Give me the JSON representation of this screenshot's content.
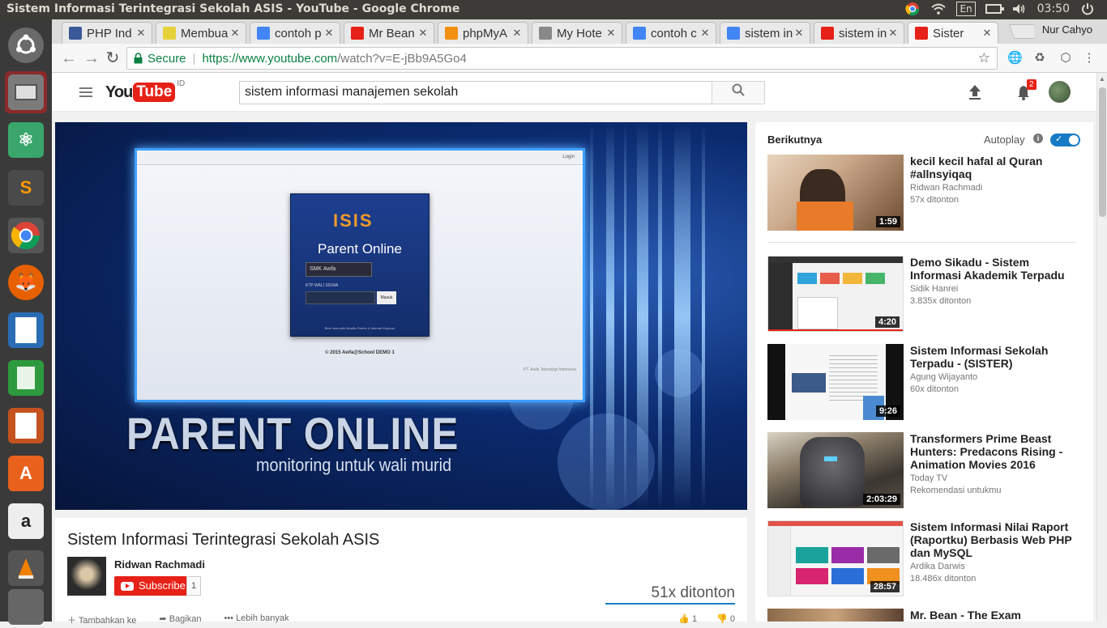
{
  "system": {
    "window_title": "Sistem Informasi Terintegrasi Sekolah ASIS - YouTube - Google Chrome",
    "lang": "En",
    "time": "03:50"
  },
  "tabs": [
    {
      "label": "PHP Ind",
      "icon": "facebook-icon",
      "color": "#3b5998"
    },
    {
      "label": "Membua",
      "icon": "chat-icon",
      "color": "#e6d13a"
    },
    {
      "label": "contoh p",
      "icon": "google-icon",
      "color": "#4285f4"
    },
    {
      "label": "Mr Bean",
      "icon": "youtube-icon",
      "color": "#e62117"
    },
    {
      "label": "phpMyA",
      "icon": "phpmyadmin-icon",
      "color": "#f29111"
    },
    {
      "label": "My Hote",
      "icon": "page-icon",
      "color": "#888888"
    },
    {
      "label": "contoh c",
      "icon": "google-icon",
      "color": "#4285f4"
    },
    {
      "label": "sistem in",
      "icon": "google-icon",
      "color": "#4285f4"
    },
    {
      "label": "sistem in",
      "icon": "youtube-icon",
      "color": "#e62117"
    },
    {
      "label": "Sister",
      "icon": "youtube-icon",
      "color": "#e62117"
    }
  ],
  "profile_name": "Nur Cahyo",
  "omnibox": {
    "secure_label": "Secure",
    "url_host": "https://www.youtube.com",
    "url_path": "/watch?v=E-jBb9A5Go4"
  },
  "youtube": {
    "logo_you": "You",
    "logo_tube": "Tube",
    "country": "ID",
    "search_value": "sistem informasi manajemen sekolah",
    "notifications": "2"
  },
  "player": {
    "screen_login": "Login",
    "isis_logo": "ISIS",
    "parent_online": "Parent Online",
    "school_select": "SMK Awfa",
    "ktp_label": "KTP WALI SISWA",
    "masuk": "Masuk",
    "best_view": "Best view with Mozilla Firefox & Internet Explorer",
    "copyright": "© 2015 Awfa@School DEMO 1",
    "company": "PT. Awfa Teknologi Indonesia",
    "headline": "PARENT ONLINE",
    "subheadline": "monitoring untuk wali murid"
  },
  "video": {
    "title": "Sistem Informasi Terintegrasi Sekolah ASIS",
    "channel": "Ridwan Rachmadi",
    "subscribe": "Subscribe",
    "subscriber_count": "1",
    "views": "51x ditonton",
    "actions": [
      "Tambahkan ke",
      "Bagikan",
      "Lebih banyak"
    ],
    "likes": "1",
    "dislikes": "0"
  },
  "sidebar": {
    "up_next": "Berikutnya",
    "autoplay": "Autoplay",
    "autoplay_on": true,
    "videos": [
      {
        "title": "kecil kecil hafal al Quran #allnsyiqaq",
        "channel": "Ridwan Rachmadi",
        "views": "57x ditonton",
        "duration": "1:59"
      },
      {
        "title": "Demo Sikadu - Sistem Informasi Akademik Terpadu",
        "channel": "Sidik Hanrei",
        "views": "3.835x ditonton",
        "duration": "4:20"
      },
      {
        "title": "Sistem Informasi Sekolah Terpadu - (SISTER)",
        "channel": "Agung Wijayanto",
        "views": "60x ditonton",
        "duration": "9:26"
      },
      {
        "title": "Transformers Prime Beast Hunters: Predacons Rising - Animation Movies 2016",
        "channel": "Today TV",
        "views": "Rekomendasi untukmu",
        "duration": "2:03:29"
      },
      {
        "title": "Sistem Informasi Nilai Raport (Raportku) Berbasis Web PHP dan MySQL",
        "channel": "Ardika Darwis",
        "views": "18.486x ditonton",
        "duration": "28:57"
      },
      {
        "title": "Mr. Bean - The Exam",
        "channel": "",
        "views": "",
        "duration": ""
      }
    ]
  }
}
